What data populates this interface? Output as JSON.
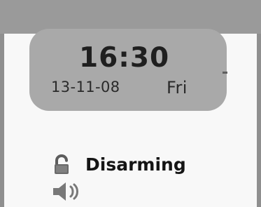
{
  "screen": {
    "clock": {
      "time": "16:30",
      "date": "13-11-08",
      "day": "Fri"
    },
    "status": {
      "label": "Disarming",
      "lock_icon": "unlocked-padlock-icon",
      "speaker_icon": "speaker-icon"
    }
  },
  "colors": {
    "background": "#f8f8f8",
    "panel": "#a9a9a9",
    "frame": "#9a9a9a",
    "text": "#1f1f1f"
  }
}
